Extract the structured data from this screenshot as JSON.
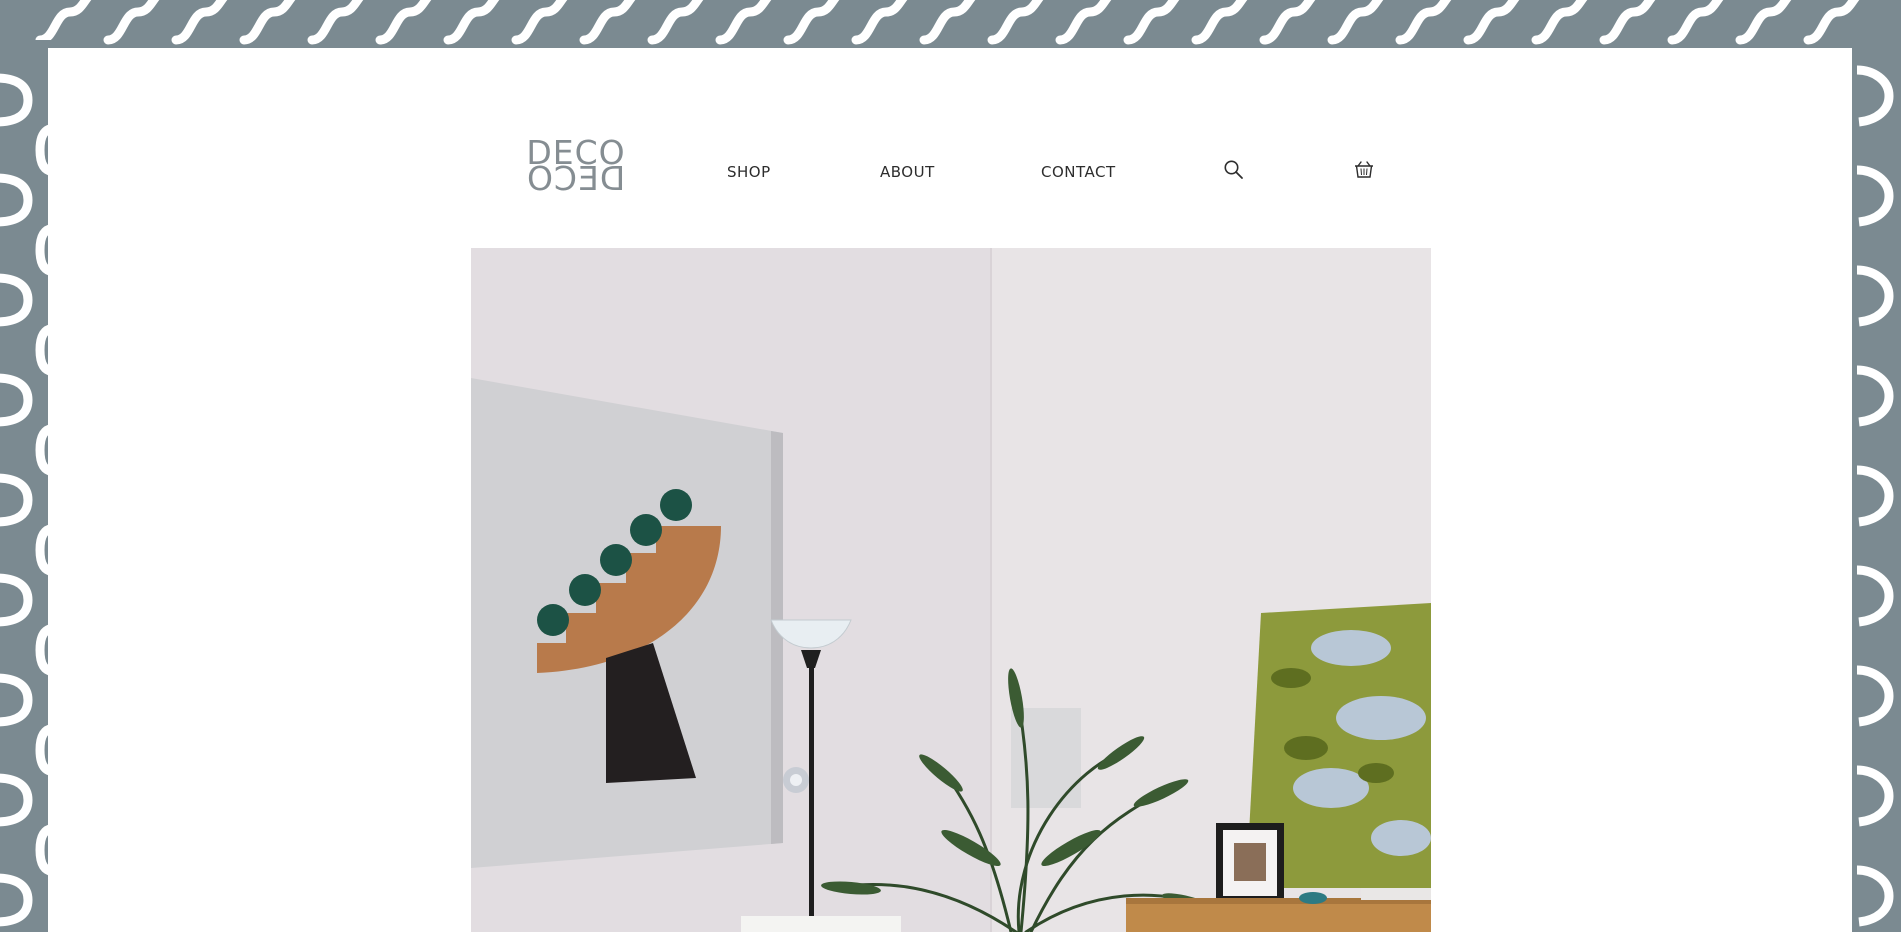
{
  "brand": {
    "logo_top": "DECO",
    "logo_bottom": "DECO"
  },
  "nav": {
    "items": [
      {
        "label": "SHOP"
      },
      {
        "label": "ABOUT"
      },
      {
        "label": "CONTACT"
      }
    ],
    "search_icon": "search-icon",
    "cart_icon": "basket-icon"
  },
  "colors": {
    "border": "#7b8a91",
    "page_bg": "#ffffff",
    "logo": "#858d92",
    "nav_text": "#2d2d2d"
  }
}
